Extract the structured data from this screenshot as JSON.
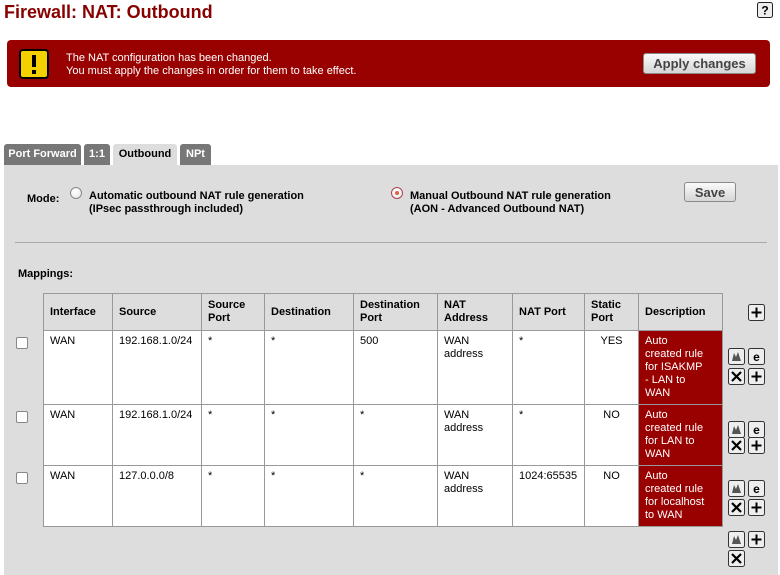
{
  "page": {
    "title": "Firewall: NAT: Outbound",
    "help_icon": "question-mark-icon"
  },
  "alert": {
    "icon": "exclamation-icon",
    "line1": "The NAT configuration has been changed.",
    "line2": "You must apply the changes in order for them to take effect.",
    "apply_label": "Apply changes",
    "background_color": "#990000"
  },
  "tabs": [
    {
      "label": "Port Forward",
      "active": false
    },
    {
      "label": "1:1",
      "active": false
    },
    {
      "label": "Outbound",
      "active": true
    },
    {
      "label": "NPt",
      "active": false
    }
  ],
  "mode": {
    "label": "Mode:",
    "option_auto": {
      "line1": "Automatic outbound NAT rule generation",
      "line2": "(IPsec passthrough included)",
      "selected": false
    },
    "option_manual": {
      "line1": "Manual Outbound NAT rule generation",
      "line2": "(AON - Advanced Outbound NAT)",
      "selected": true
    },
    "save_label": "Save"
  },
  "mappings": {
    "label": "Mappings:",
    "columns": [
      {
        "line1": "Interface",
        "line2": ""
      },
      {
        "line1": "Source",
        "line2": ""
      },
      {
        "line1": "Source",
        "line2": "Port"
      },
      {
        "line1": "Destination",
        "line2": ""
      },
      {
        "line1": "Destination",
        "line2": "Port"
      },
      {
        "line1": "NAT",
        "line2": "Address"
      },
      {
        "line1": "NAT Port",
        "line2": ""
      },
      {
        "line1": "Static",
        "line2": "Port"
      },
      {
        "line1": "Description",
        "line2": ""
      }
    ],
    "rows": [
      {
        "interface": "WAN",
        "source": "192.168.1.0/24",
        "source_port": "*",
        "destination": "*",
        "destination_port": "500",
        "nat_address_l1": "WAN",
        "nat_address_l2": "address",
        "nat_port": "*",
        "static_port": "YES",
        "desc1": "Auto",
        "desc2": "created rule",
        "desc3": "for ISAKMP",
        "desc4": "- LAN to",
        "desc5": "WAN"
      },
      {
        "interface": "WAN",
        "source": "192.168.1.0/24",
        "source_port": "*",
        "destination": "*",
        "destination_port": "*",
        "nat_address_l1": "WAN",
        "nat_address_l2": "address",
        "nat_port": "*",
        "static_port": "NO",
        "desc1": "Auto",
        "desc2": "created rule",
        "desc3": "for LAN to",
        "desc4": "WAN"
      },
      {
        "interface": "WAN",
        "source": "127.0.0.0/8",
        "source_port": "*",
        "destination": "*",
        "destination_port": "*",
        "nat_address_l1": "WAN",
        "nat_address_l2": "address",
        "nat_port": "1024:65535",
        "static_port": "NO",
        "desc1": "Auto",
        "desc2": "created rule",
        "desc3": "for localhost",
        "desc4": "to WAN"
      }
    ],
    "row_action_icons": [
      "move-rule-icon",
      "edit-rule-icon",
      "delete-rule-icon",
      "add-rule-icon"
    ],
    "description_color": "#990000"
  }
}
